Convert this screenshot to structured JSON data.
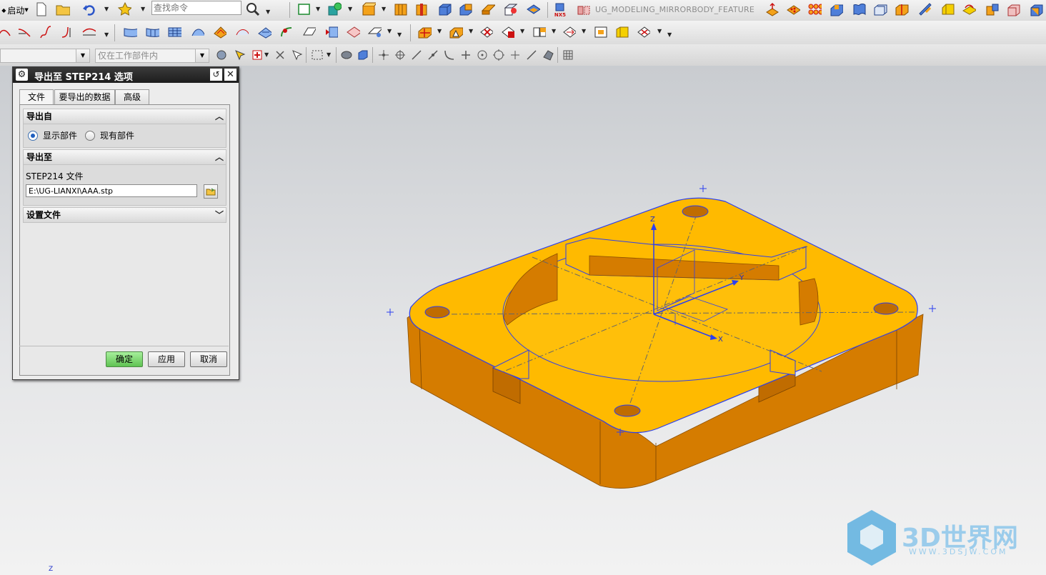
{
  "toolbar": {
    "start_label": "启动",
    "search_placeholder": "查找命令",
    "feature_name": "UG_MODELING_MIRRORBODY_FEATURE",
    "nx5_badge": "NX5",
    "selection_scope": "仅在工作部件内",
    "filter_value": ""
  },
  "dialog": {
    "title": "导出至 STEP214 选项",
    "tabs": [
      "文件",
      "要导出的数据",
      "高级"
    ],
    "export_from": {
      "header": "导出自",
      "options": [
        "显示部件",
        "现有部件"
      ],
      "selected": 0
    },
    "export_to": {
      "header": "导出至",
      "file_label": "STEP214 文件",
      "file_value": "E:\\UG-LIANXI\\AAA.stp"
    },
    "settings": {
      "header": "设置文件"
    },
    "buttons": {
      "ok": "确定",
      "apply": "应用",
      "cancel": "取消"
    }
  },
  "viewport": {
    "axis_labels": {
      "z": "Z",
      "y": "Y",
      "x": "X"
    },
    "corner_axis": "Z",
    "part_color": "#ffba00",
    "part_side_color": "#d57c00",
    "edge_color": "#2b3ff0"
  },
  "watermark": {
    "text": "3D世界网",
    "url": "WWW.3DSJW.COM"
  }
}
